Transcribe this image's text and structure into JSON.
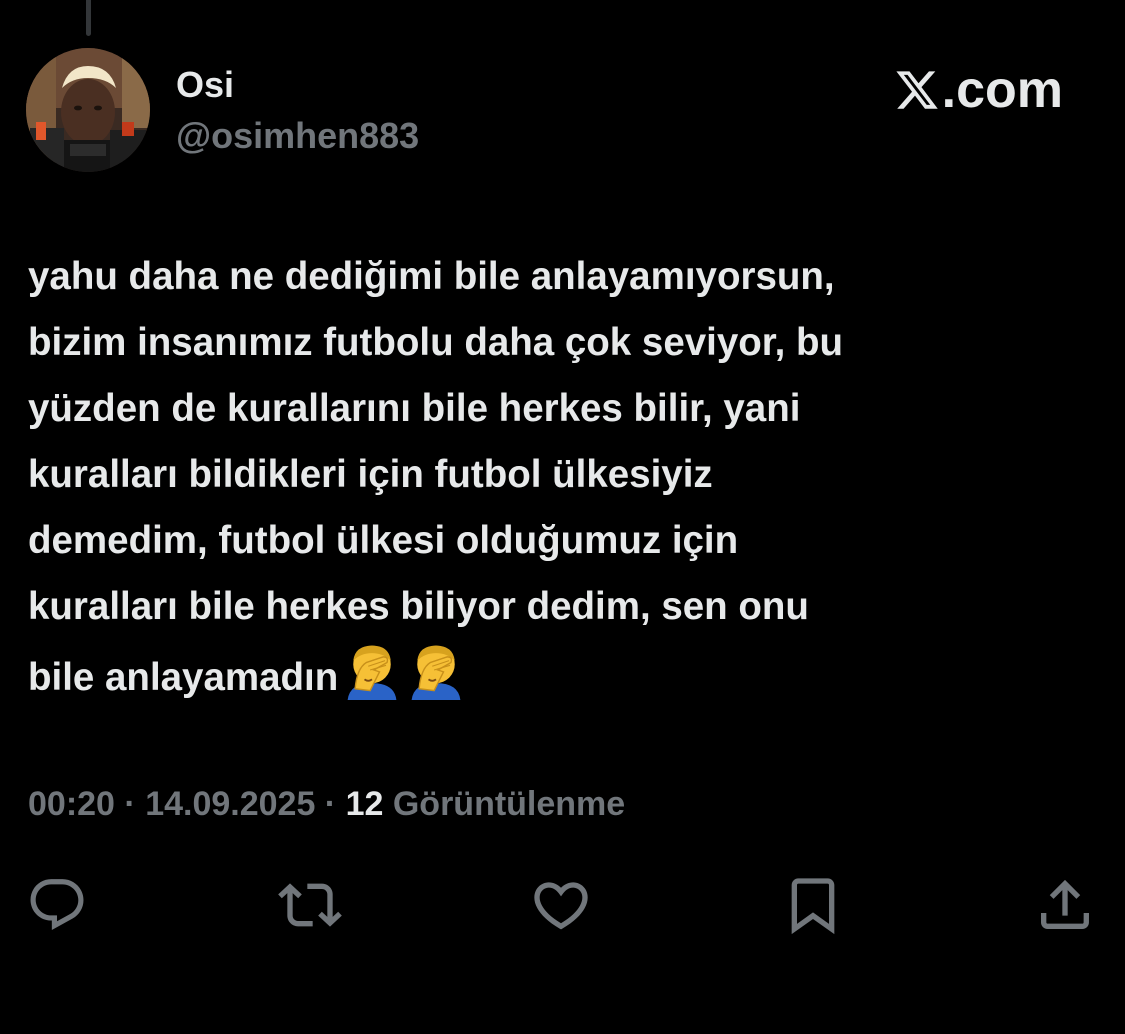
{
  "author": {
    "display_name": "Osi",
    "handle": "@osimhen883"
  },
  "brand": {
    "label": ".com",
    "icon": "x-logo-icon"
  },
  "tweet": {
    "lines": [
      "yahu daha ne dediğimi bile anlayamıyorsun,",
      "bizim insanımız futbolu daha çok seviyor, bu",
      "yüzden de kurallarını bile herkes bilir, yani",
      "kuralları bildikleri için futbol ülkesiyiz",
      "demedim, futbol ülkesi olduğumuz için",
      "kuralları bile herkes biliyor dedim, sen onu",
      "bile anlayamadın"
    ],
    "emoji": [
      "man-facepalming-icon",
      "man-facepalming-icon"
    ]
  },
  "meta": {
    "time": "00:20",
    "separator": " · ",
    "date": "14.09.2025",
    "views_count": "12",
    "views_label": " Görüntülenme"
  },
  "actions": [
    {
      "name": "reply",
      "icon": "reply-icon"
    },
    {
      "name": "repost",
      "icon": "repost-icon"
    },
    {
      "name": "like",
      "icon": "heart-icon"
    },
    {
      "name": "bookmark",
      "icon": "bookmark-icon"
    },
    {
      "name": "share",
      "icon": "share-icon"
    }
  ],
  "colors": {
    "background": "#000000",
    "primary_text": "#e7e9ea",
    "secondary_text": "#71767b",
    "emoji_skin": "#f6c036",
    "emoji_shirt": "#2a63c7"
  }
}
